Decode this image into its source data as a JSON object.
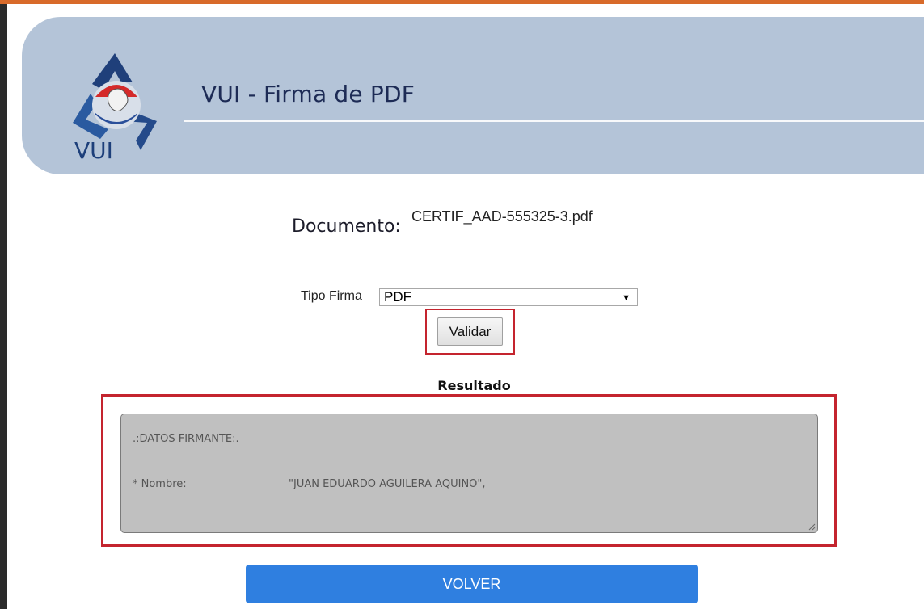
{
  "header": {
    "title": "VUI - Firma de PDF",
    "logo_text": "VUI"
  },
  "form": {
    "documento_label": "Documento:",
    "documento_value": "CERTIF_AAD-555325-3.pdf",
    "tipo_firma_label": "Tipo Firma",
    "tipo_firma_selected": "PDF",
    "validar_label": "Validar"
  },
  "resultado": {
    "title": "Resultado",
    "section_heading": ".:DATOS FIRMANTE:.",
    "nombre_label": "* Nombre:",
    "nombre_value": "\"JUAN EDUARDO AGUILERA AQUINO\","
  },
  "actions": {
    "volver_label": "VOLVER"
  },
  "colors": {
    "banner": "#b4c4d8",
    "title_text": "#1d2b55",
    "highlight": "#c4242e",
    "volver_button": "#2f7fe0",
    "result_bg": "#c0c0c0"
  }
}
